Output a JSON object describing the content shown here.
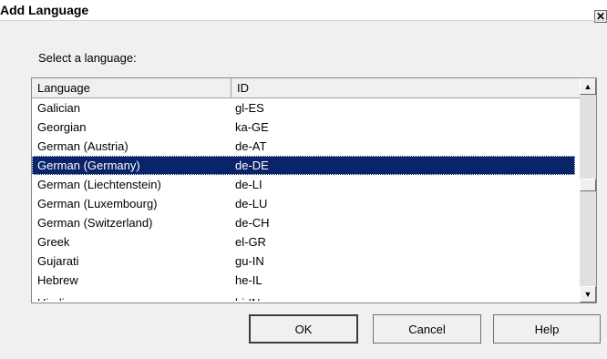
{
  "dialog": {
    "title": "Add Language",
    "close_label": "✕",
    "prompt": "Select a language:"
  },
  "list": {
    "columns": {
      "language": "Language",
      "id": "ID"
    },
    "rows": [
      {
        "language": "Galician",
        "id": "gl-ES",
        "selected": false
      },
      {
        "language": "Georgian",
        "id": "ka-GE",
        "selected": false
      },
      {
        "language": "German (Austria)",
        "id": "de-AT",
        "selected": false
      },
      {
        "language": "German (Germany)",
        "id": "de-DE",
        "selected": true
      },
      {
        "language": "German (Liechtenstein)",
        "id": "de-LI",
        "selected": false
      },
      {
        "language": "German (Luxembourg)",
        "id": "de-LU",
        "selected": false
      },
      {
        "language": "German (Switzerland)",
        "id": "de-CH",
        "selected": false
      },
      {
        "language": "Greek",
        "id": "el-GR",
        "selected": false
      },
      {
        "language": "Gujarati",
        "id": "gu-IN",
        "selected": false
      },
      {
        "language": "Hebrew",
        "id": "he-IL",
        "selected": false
      },
      {
        "language": "Hindi",
        "id": "hi-IN",
        "selected": false
      }
    ],
    "scroll_up_icon": "triangle-up-icon",
    "scroll_down_icon": "triangle-down-icon"
  },
  "buttons": {
    "ok": "OK",
    "cancel": "Cancel",
    "help": "Help"
  },
  "colors": {
    "selection": "#0a246a",
    "background": "#f0f0f0"
  }
}
